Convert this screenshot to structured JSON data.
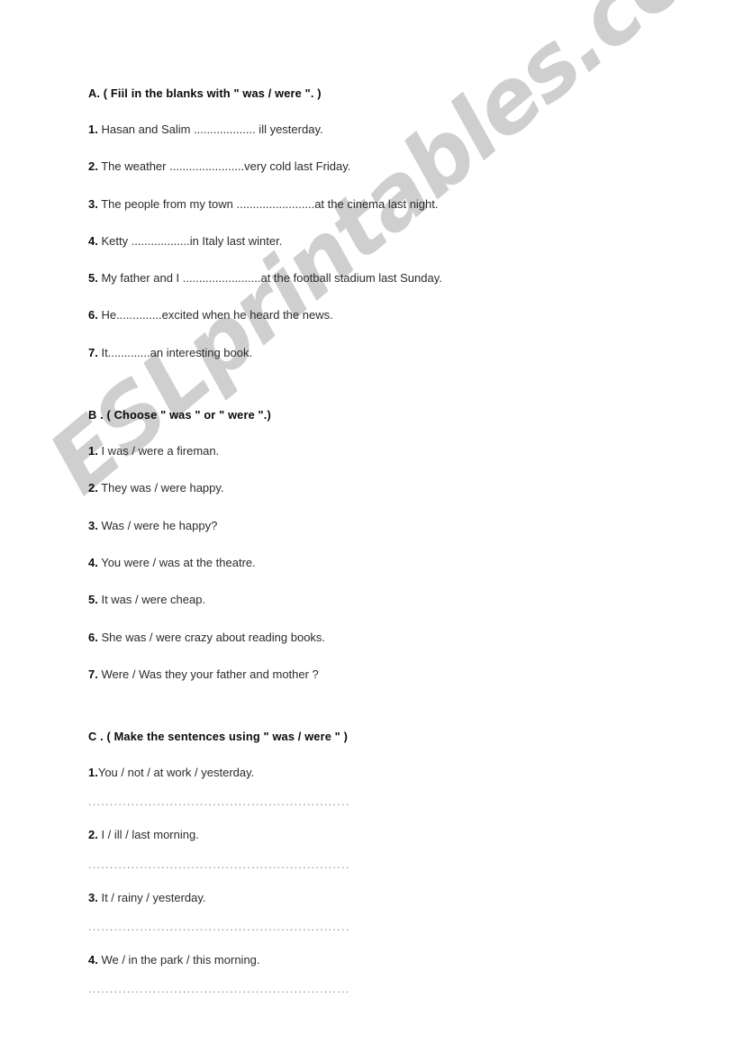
{
  "watermark": {
    "text": "ESLprintables.com",
    "color": "#cdcdcd",
    "rotation_deg": -40
  },
  "page": {
    "background_color": "#ffffff",
    "text_color": "#2b2b2b",
    "heading_color": "#0a0a0a"
  },
  "sections": [
    {
      "id": "A",
      "heading": "A. ( Fiil in the blanks with \" was / were \". )",
      "items": [
        {
          "num": "1.",
          "text": " Hasan and Salim ................... ill yesterday."
        },
        {
          "num": "2.",
          "text": " The weather .......................very cold last Friday."
        },
        {
          "num": "3.",
          "text": " The people from my town ........................at the cinema last night."
        },
        {
          "num": "4.",
          "text": " Ketty ..................in Italy last winter."
        },
        {
          "num": "5.",
          "text": " My father and I ........................at the football stadium last Sunday."
        },
        {
          "num": "6.",
          "text": " He..............excited when he heard the news."
        },
        {
          "num": "7.",
          "text": " It.............an interesting book."
        }
      ]
    },
    {
      "id": "B",
      "heading": "B . ( Choose \" was \" or \" were \".)",
      "items": [
        {
          "num": "1.",
          "text": " I was / were a fireman."
        },
        {
          "num": "2.",
          "text": " They was / were happy."
        },
        {
          "num": "3.",
          "text": " Was / were he happy?"
        },
        {
          "num": "4.",
          "text": " You were / was at the theatre."
        },
        {
          "num": "5.",
          "text": " It was / were cheap."
        },
        {
          "num": "6.",
          "text": " She was / were crazy about reading books."
        },
        {
          "num": "7.",
          "text": " Were / Was they your father and mother ?"
        }
      ]
    },
    {
      "id": "C",
      "heading": "C . ( Make the sentences using \" was / were \" )",
      "answer_line": "..................................................................",
      "items": [
        {
          "num": "1.",
          "text": "You / not / at work / yesterday."
        },
        {
          "num": "2.",
          "text": " I / ill / last morning."
        },
        {
          "num": "3.",
          "text": " It / rainy / yesterday."
        },
        {
          "num": "4.",
          "text": " We / in the park / this morning."
        }
      ]
    }
  ]
}
